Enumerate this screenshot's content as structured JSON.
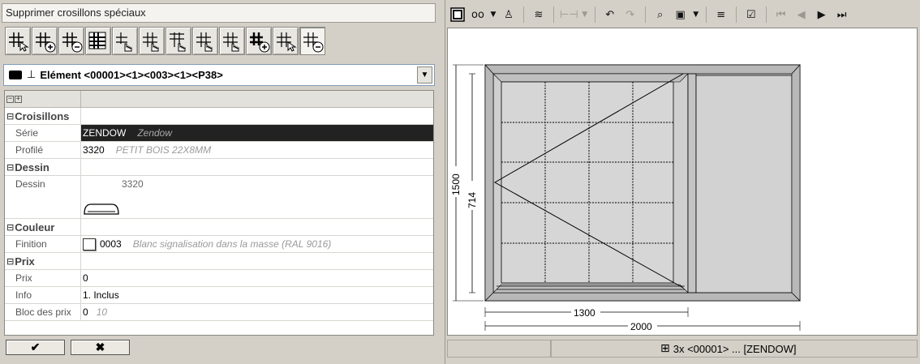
{
  "left": {
    "title": "Supprimer crosillons spéciaux",
    "element_combo": "Elément <00001><1><003><1><P38>",
    "properties": {
      "croisillons_header": "Croisillons",
      "serie_label": "Série",
      "serie_value": "ZENDOW",
      "serie_desc": "Zendow",
      "profile_label": "Profilé",
      "profile_value": "3320",
      "profile_desc": "PETIT BOIS 22X8MM",
      "dessin_header": "Dessin",
      "dessin_label": "Dessin",
      "dessin_value": "3320",
      "couleur_header": "Couleur",
      "finition_label": "Finition",
      "finition_value": "0003",
      "finition_desc": "Blanc signalisation dans la masse (RAL 9016)",
      "prix_header": "Prix",
      "prix_label": "Prix",
      "prix_value": "0",
      "info_label": "Info",
      "info_value": "1. Inclus",
      "bloc_label": "Bloc des prix",
      "bloc_value": "0",
      "bloc_desc": "10"
    },
    "ok_label": "✔",
    "cancel_label": "✖"
  },
  "drawing": {
    "dim_height": "1500",
    "dim_sash_height": "714",
    "dim_sash_width": "1300",
    "dim_total_width": "2000"
  },
  "status": {
    "text": "3x <00001> ... [ZENDOW]"
  }
}
